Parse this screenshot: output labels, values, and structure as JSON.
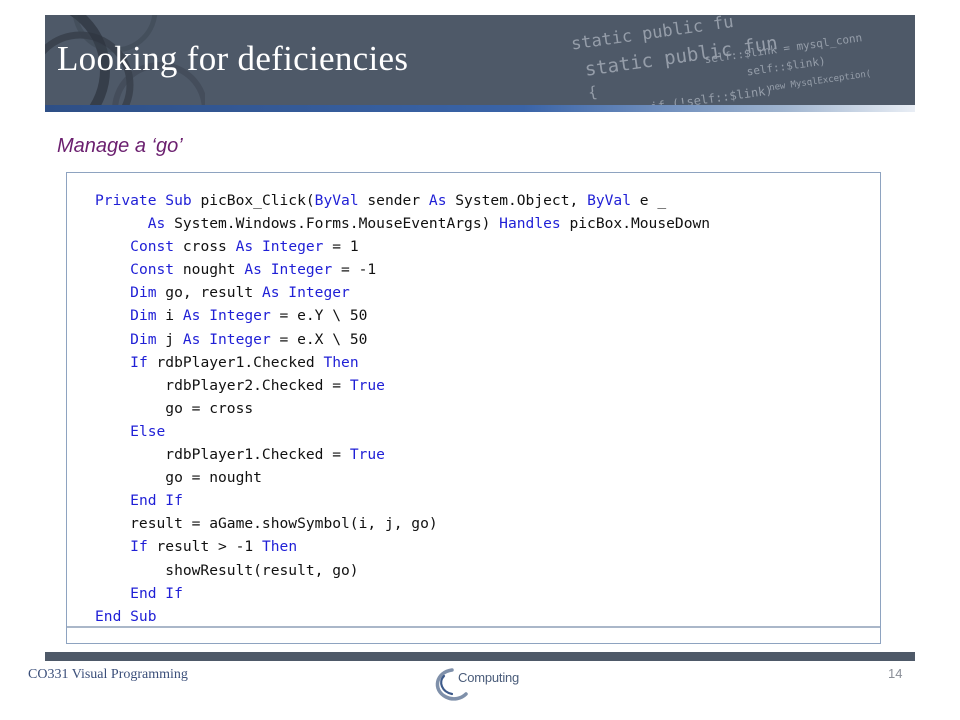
{
  "slide": {
    "title": "Looking for deficiencies",
    "subtitle": "Manage a ‘go’",
    "header_background_code": [
      "static public fu",
      "static public fun",
      "self::$link = mysql_conn",
      "{",
      "self::$link)",
      "if (!self::$link)",
      "new MysqlException("
    ],
    "colors": {
      "header": "#4e5968",
      "subtitle": "#6b1f6f",
      "keyword": "#1f1fd6",
      "rule": "#2e4f86"
    }
  },
  "code": {
    "lines": [
      [
        {
          "t": "Private Sub",
          "k": true
        },
        {
          "t": " picBox_Click("
        },
        {
          "t": "ByVal",
          "k": true
        },
        {
          "t": " sender "
        },
        {
          "t": "As",
          "k": true
        },
        {
          "t": " System.Object, "
        },
        {
          "t": "ByVal",
          "k": true
        },
        {
          "t": " e _"
        }
      ],
      [
        {
          "t": "      "
        },
        {
          "t": "As",
          "k": true
        },
        {
          "t": " System.Windows.Forms.MouseEventArgs) "
        },
        {
          "t": "Handles",
          "k": true
        },
        {
          "t": " picBox.MouseDown"
        }
      ],
      [
        {
          "t": "    "
        },
        {
          "t": "Const",
          "k": true
        },
        {
          "t": " cross "
        },
        {
          "t": "As Integer",
          "k": true
        },
        {
          "t": " = 1"
        }
      ],
      [
        {
          "t": "    "
        },
        {
          "t": "Const",
          "k": true
        },
        {
          "t": " nought "
        },
        {
          "t": "As Integer",
          "k": true
        },
        {
          "t": " = -1"
        }
      ],
      [
        {
          "t": "    "
        },
        {
          "t": "Dim",
          "k": true
        },
        {
          "t": " go, result "
        },
        {
          "t": "As Integer",
          "k": true
        }
      ],
      [
        {
          "t": "    "
        },
        {
          "t": "Dim",
          "k": true
        },
        {
          "t": " i "
        },
        {
          "t": "As Integer",
          "k": true
        },
        {
          "t": " = e.Y \\ 50"
        }
      ],
      [
        {
          "t": "    "
        },
        {
          "t": "Dim",
          "k": true
        },
        {
          "t": " j "
        },
        {
          "t": "As Integer",
          "k": true
        },
        {
          "t": " = e.X \\ 50"
        }
      ],
      [
        {
          "t": "    "
        },
        {
          "t": "If",
          "k": true
        },
        {
          "t": " rdbPlayer1.Checked "
        },
        {
          "t": "Then",
          "k": true
        }
      ],
      [
        {
          "t": "        rdbPlayer2.Checked = "
        },
        {
          "t": "True",
          "k": true
        }
      ],
      [
        {
          "t": "        go = cross"
        }
      ],
      [
        {
          "t": "    "
        },
        {
          "t": "Else",
          "k": true
        }
      ],
      [
        {
          "t": "        rdbPlayer1.Checked = "
        },
        {
          "t": "True",
          "k": true
        }
      ],
      [
        {
          "t": "        go = nought"
        }
      ],
      [
        {
          "t": "    "
        },
        {
          "t": "End If",
          "k": true
        }
      ],
      [
        {
          "t": "    result = aGame.showSymbol(i, j, go)"
        }
      ],
      [
        {
          "t": "    "
        },
        {
          "t": "If",
          "k": true
        },
        {
          "t": " result > -1 "
        },
        {
          "t": "Then",
          "k": true
        }
      ],
      [
        {
          "t": "        showResult(result, go)"
        }
      ],
      [
        {
          "t": "    "
        },
        {
          "t": "End If",
          "k": true
        }
      ],
      [
        {
          "t": "End Sub",
          "k": true
        }
      ]
    ]
  },
  "footer": {
    "course": "CO331 Visual Programming",
    "logo_text": "Computing",
    "logo_icon": "computing-swoosh-icon",
    "page_number": "14"
  }
}
